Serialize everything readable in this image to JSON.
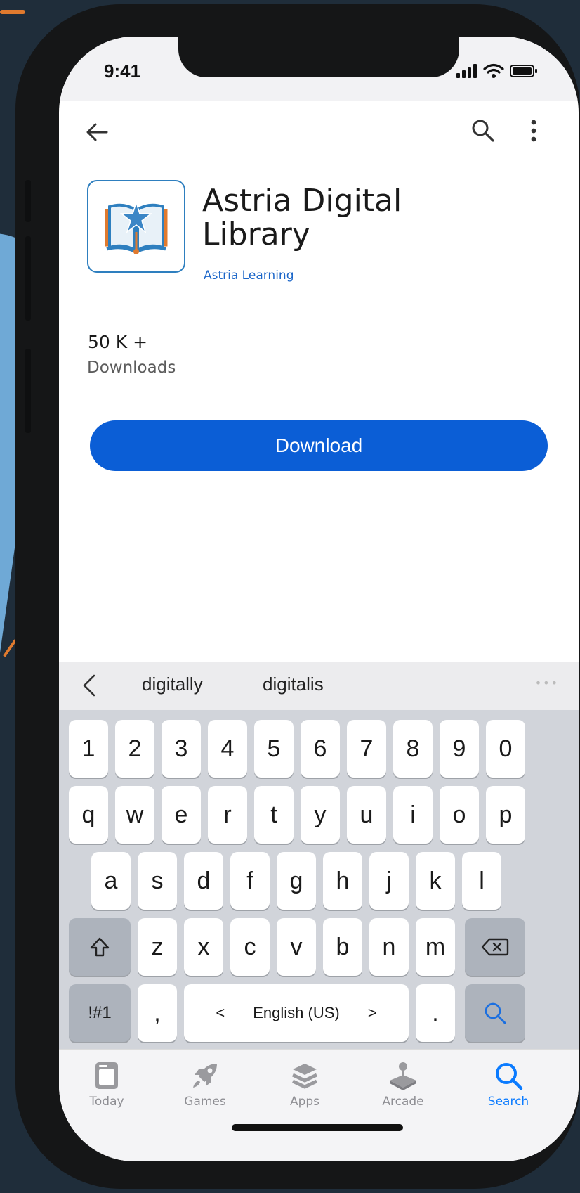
{
  "status_bar": {
    "time": "9:41"
  },
  "header": {
    "back_icon": "arrow-left-icon",
    "search_icon": "search-icon",
    "more_icon": "more-vertical-icon"
  },
  "app": {
    "title_line1": "Astria Digital",
    "title_line2": "Library",
    "developer": "Astria Learning",
    "icon": "open-book-star-icon"
  },
  "stats": {
    "downloads_value": "50 K +",
    "downloads_label": "Downloads"
  },
  "actions": {
    "download_label": "Download"
  },
  "colors": {
    "primary": "#0b5ed6",
    "accent_link": "#1b66c9",
    "active_tab": "#0b7bff",
    "icon_orange": "#e07a2e",
    "icon_blue": "#2e7fbf"
  },
  "keyboard": {
    "suggestions": [
      "digitally",
      "digitalis"
    ],
    "row_numbers": [
      "1",
      "2",
      "3",
      "4",
      "5",
      "6",
      "7",
      "8",
      "9",
      "0"
    ],
    "row_1": [
      "q",
      "w",
      "e",
      "r",
      "t",
      "y",
      "u",
      "i",
      "o",
      "p"
    ],
    "row_2": [
      "a",
      "s",
      "d",
      "f",
      "g",
      "h",
      "j",
      "k",
      "l"
    ],
    "row_3": [
      "z",
      "x",
      "c",
      "v",
      "b",
      "n",
      "m"
    ],
    "symbols_key": "!#1",
    "comma_key": ",",
    "period_key": ".",
    "language": "English (US)",
    "lang_prev": "<",
    "lang_next": ">"
  },
  "tabs": [
    {
      "label": "Today",
      "icon": "today-icon",
      "active": false
    },
    {
      "label": "Games",
      "icon": "rocket-icon",
      "active": false
    },
    {
      "label": "Apps",
      "icon": "layers-icon",
      "active": false
    },
    {
      "label": "Arcade",
      "icon": "joystick-icon",
      "active": false
    },
    {
      "label": "Search",
      "icon": "search-icon",
      "active": true
    }
  ]
}
